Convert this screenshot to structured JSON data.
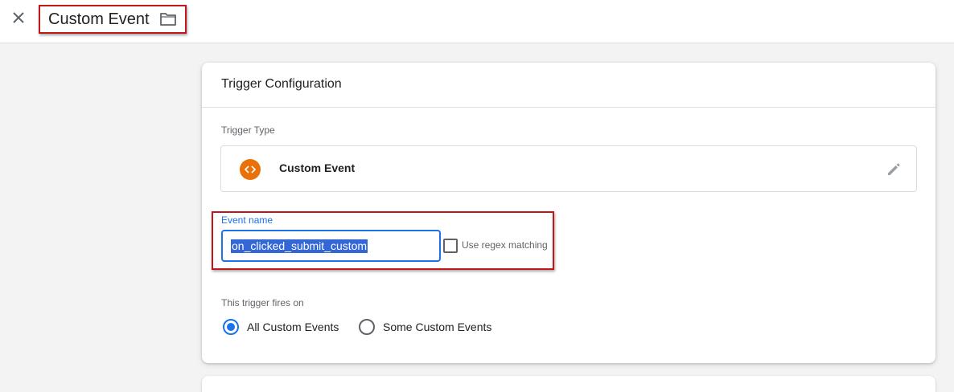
{
  "header": {
    "title": "Custom Event",
    "close_icon": "close-icon",
    "folder_icon": "folder-icon"
  },
  "trigger_config": {
    "title": "Trigger Configuration",
    "trigger_type_label": "Trigger Type",
    "trigger_type_name": "Custom Event",
    "trigger_type_icon": "custom-event-code-icon",
    "edit_icon": "pencil-icon",
    "event_name_label": "Event name",
    "event_name_value": "on_clicked_submit_custom",
    "regex_label": "Use regex matching",
    "regex_checked": false,
    "fires_on_label": "This trigger fires on",
    "fires_on_options": [
      {
        "label": "All Custom Events",
        "selected": true
      },
      {
        "label": "Some Custom Events",
        "selected": false
      }
    ]
  },
  "colors": {
    "accent": "#1a73e8",
    "icon_orange": "#e8710a",
    "annotation_red": "#c0161a",
    "background": "#f3f3f3"
  }
}
